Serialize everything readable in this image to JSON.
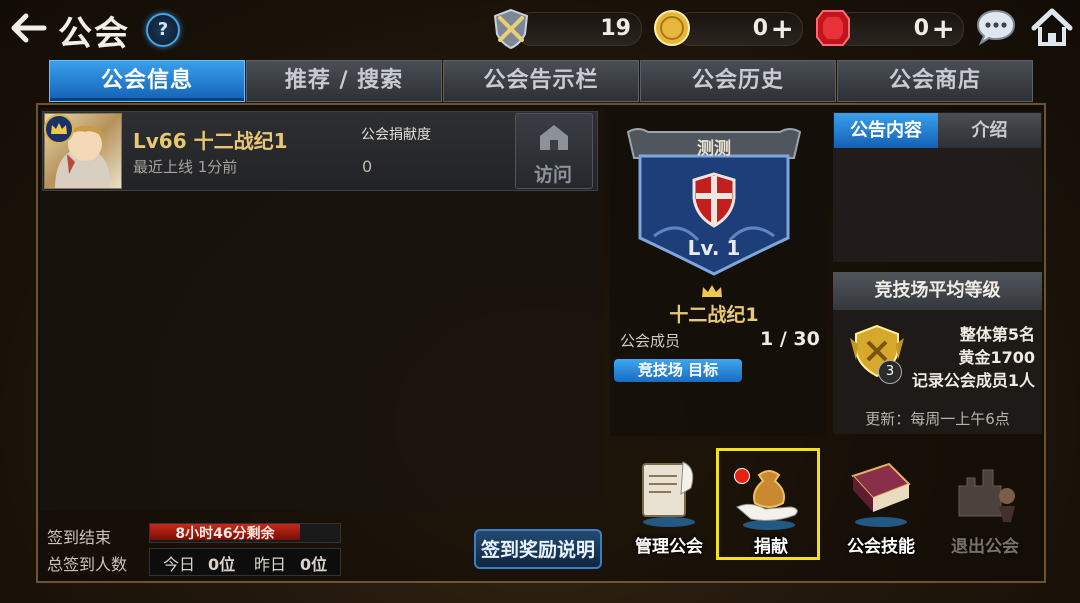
{
  "header": {
    "title": "公会",
    "help_symbol": "?"
  },
  "resources": [
    {
      "name": "arena-token",
      "value": "19",
      "plus": ""
    },
    {
      "name": "gold",
      "value": "0",
      "plus": "+"
    },
    {
      "name": "ruby",
      "value": "0",
      "plus": "+"
    }
  ],
  "tabs": [
    "公会信息",
    "推荐 / 搜索",
    "公会告示栏",
    "公会历史",
    "公会商店"
  ],
  "member": {
    "name": "Lv66  十二战纪1",
    "last_online": "最近上线 1分前",
    "contribution_label": "公会捐献度",
    "contribution": "0",
    "visit_label": "访问"
  },
  "checkin": {
    "end_label": "签到结束",
    "time_left": "8小时46分剩余",
    "total_label": "总签到人数",
    "today_label": "今日",
    "today_value": "0位",
    "yesterday_label": "昨日",
    "yesterday_value": "0位",
    "reward_button": "签到奖励说明"
  },
  "guild": {
    "name": "测测",
    "level": "Lv. 1",
    "leader": "十二战纪1",
    "members_label": "公会成员",
    "members_value": "1 / 30",
    "arena_target": "竞技场 目标"
  },
  "notice": {
    "tab_content": "公告内容",
    "tab_intro": "介绍"
  },
  "arena": {
    "title": "竞技场平均等级",
    "rank": "整体第5名",
    "tier": "黄金1700",
    "recorded": "记录公会成员1人",
    "update": "更新：每周一上午6点",
    "badge_level": "3"
  },
  "actions": {
    "manage": "管理公会",
    "donate": "捐献",
    "skill": "公会技能",
    "leave": "退出公会"
  }
}
